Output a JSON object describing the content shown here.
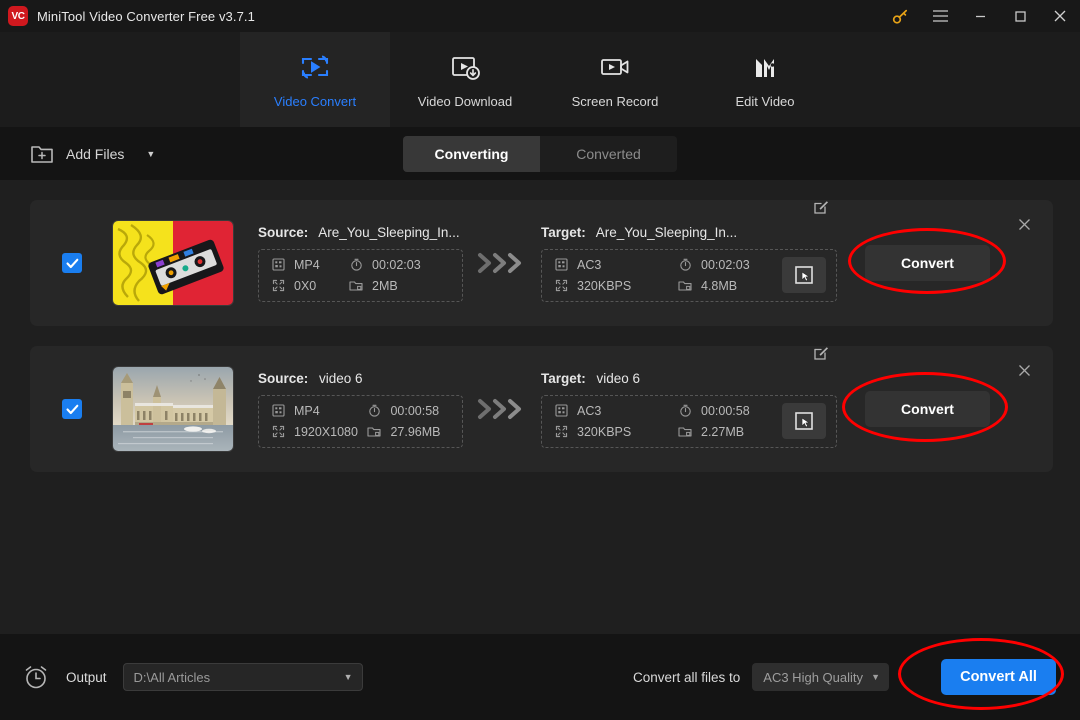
{
  "window": {
    "title": "MiniTool Video Converter Free v3.7.1",
    "logo_text": "VC",
    "controls": {
      "key": "key-icon",
      "menu": "hamburger-menu-icon",
      "minimize": "minimize-icon",
      "maximize": "maximize-icon",
      "close": "close-icon"
    }
  },
  "nav": {
    "items": [
      {
        "label": "Video Convert",
        "icon": "video-convert-icon",
        "active": true
      },
      {
        "label": "Video Download",
        "icon": "video-download-icon",
        "active": false
      },
      {
        "label": "Screen Record",
        "icon": "screen-record-icon",
        "active": false
      },
      {
        "label": "Edit Video",
        "icon": "edit-video-icon",
        "active": false
      }
    ]
  },
  "toolbar": {
    "add_files_label": "Add Files",
    "add_files_icon": "add-folder-icon",
    "tabs": [
      {
        "label": "Converting",
        "active": true
      },
      {
        "label": "Converted",
        "active": false
      }
    ]
  },
  "files": [
    {
      "checked": true,
      "thumbnail": "cassette-tape-thumbnail",
      "source": {
        "label": "Source:",
        "name": "Are_You_Sleeping_In...",
        "format": "MP4",
        "duration": "00:02:03",
        "resolution": "0X0",
        "size": "2MB"
      },
      "target": {
        "label": "Target:",
        "name": "Are_You_Sleeping_In...",
        "format": "AC3",
        "duration": "00:02:03",
        "bitrate": "320KBPS",
        "size": "4.8MB"
      },
      "convert_label": "Convert",
      "annotated": true
    },
    {
      "checked": true,
      "thumbnail": "westminster-palace-thumbnail",
      "source": {
        "label": "Source:",
        "name": "video 6",
        "format": "MP4",
        "duration": "00:00:58",
        "resolution": "1920X1080",
        "size": "27.96MB"
      },
      "target": {
        "label": "Target:",
        "name": "video 6",
        "format": "AC3",
        "duration": "00:00:58",
        "bitrate": "320KBPS",
        "size": "2.27MB"
      },
      "convert_label": "Convert",
      "annotated": true
    }
  ],
  "bottom": {
    "clock_icon": "alarm-clock-icon",
    "output_label": "Output",
    "output_path": "D:\\All Articles",
    "convert_all_to_label": "Convert all files to",
    "preset_value": "AC3 High Quality",
    "convert_all_label": "Convert All"
  },
  "colors": {
    "accent_blue": "#1a7ef0",
    "annotation_red": "#ff0000",
    "logo_red": "#d0181e",
    "key_gold": "#e8a317",
    "window_bg": "#1f1f1f",
    "card_bg": "#272727"
  }
}
